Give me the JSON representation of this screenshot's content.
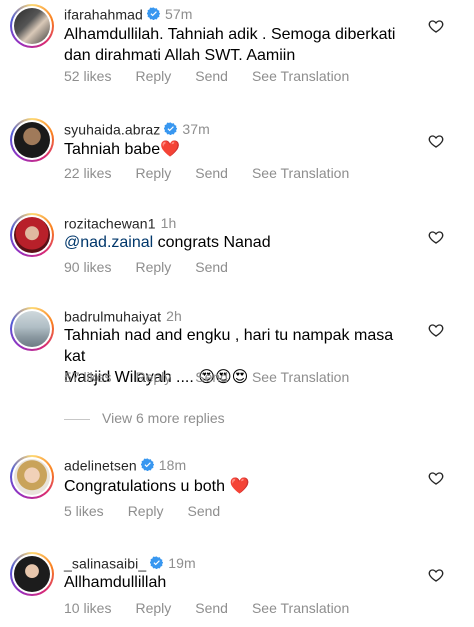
{
  "comments": [
    {
      "username": "ifarahahmad",
      "verified": true,
      "time": "57m",
      "text_lines": [
        "Alhamdullilah. Tahniah adik . Semoga diberkati",
        "dan dirahmati Allah SWT. Aamiin"
      ],
      "likes": "52 likes",
      "reply": "Reply",
      "send": "Send",
      "translate": "See Translation"
    },
    {
      "username": "syuhaida.abraz",
      "verified": true,
      "time": "37m",
      "text": "Tahniah babe",
      "emoji": "❤️",
      "likes": "22 likes",
      "reply": "Reply",
      "send": "Send",
      "translate": "See Translation"
    },
    {
      "username": "rozitachewan1",
      "verified": false,
      "time": "1h",
      "mention": "@nad.zainal",
      "text": " congrats Nanad",
      "likes": "90 likes",
      "reply": "Reply",
      "send": "Send"
    },
    {
      "username": "badrulmuhaiyat",
      "verified": false,
      "time": "2h",
      "text_lines": [
        "Tahniah nad and engku , hari tu nampak masa kat",
        "Masjid Wilayah .... "
      ],
      "emoji": "😍😍😍",
      "likes": "57 likes",
      "reply": "Reply",
      "send": "Send",
      "translate": "See Translation"
    },
    {
      "username": "adelinetsen",
      "verified": true,
      "time": "18m",
      "text": "Congratulations u both ",
      "emoji": "❤️",
      "likes": "5 likes",
      "reply": "Reply",
      "send": "Send"
    },
    {
      "username": "_salinasaibi_",
      "verified": true,
      "time": "19m",
      "text": "Allhamdullillah",
      "likes": "10 likes",
      "reply": "Reply",
      "send": "Send",
      "translate": "See Translation"
    }
  ],
  "view_replies": "View 6 more replies",
  "icons": {
    "like": "heart-outline-icon",
    "verified": "verified-badge-icon"
  },
  "colors": {
    "verified": "#3897f0",
    "meta": "#8e8e8e",
    "mention": "#00376b"
  }
}
